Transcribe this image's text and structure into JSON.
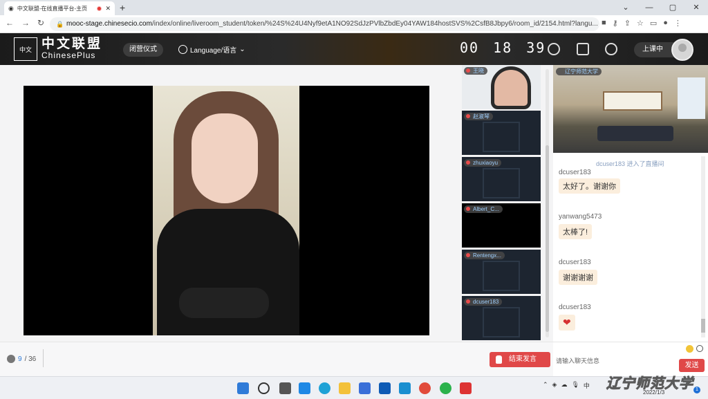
{
  "browser": {
    "tab_title": "中文联盟-在线直播平台-主页",
    "url_host": "mooc-stage.chinesecio.com",
    "url_path": "/index/online/liveroom_student/token/%24S%24U4Nyf9etA1NO92SdJzPVlbZbdEy04YAW184hostSVS%2CsfB8Jbpy6/room_id/2154.html?langu..."
  },
  "header": {
    "logo_text": "中文",
    "brand_cn": "中文联盟",
    "brand_en": "ChinesePlus",
    "ceremony_label": "闭营仪式",
    "language_label": "Language/语言",
    "timer": {
      "h": "00",
      "m": "18",
      "s": "39"
    },
    "end_class_label": "上课中"
  },
  "participants": [
    {
      "name": "王晓"
    },
    {
      "name": "赵淑琴"
    },
    {
      "name": "zhuxiaoyu"
    },
    {
      "name": "Albert_C..."
    },
    {
      "name": "Rentengx..."
    },
    {
      "name": "dcuser183"
    }
  ],
  "room_label": "辽宁师范大学",
  "chat": {
    "system_msg": "dcuser183 进入了直播间",
    "messages": [
      {
        "user": "dcuser183",
        "text": "太好了。谢谢你"
      },
      {
        "user": "yanwang5473",
        "text": "太棒了!"
      },
      {
        "user": "dcuser183",
        "text": "谢谢谢谢"
      },
      {
        "user": "dcuser183",
        "text": "❤"
      }
    ],
    "input_placeholder": "请输入聊天信息",
    "send_label": "发送"
  },
  "footer": {
    "online_current": "9",
    "online_total": "/ 36",
    "end_talk_label": "结束发言"
  },
  "taskbar": {
    "date": "2022/1/3",
    "notification_count": "1",
    "tray_lang": "中"
  },
  "watermark": "辽宁师范大学",
  "colors": {
    "accent_red": "#e04848",
    "header_bg": "#1b1b1b"
  }
}
